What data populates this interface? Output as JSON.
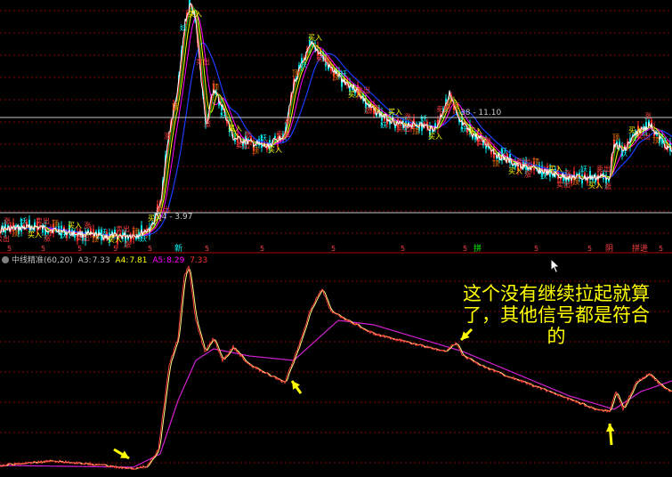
{
  "colors": {
    "background": "#000000",
    "grid": "#8a0000",
    "price_line": "#ffffff",
    "ma_blue": "#1a3cff",
    "ma_yellow": "#ffff00",
    "ma_magenta": "#ff00ff",
    "ma_red": "#ff2020",
    "ma_green": "#00c000",
    "annotation": "#ffff00"
  },
  "price_panel": {
    "high_marker": "38 - 11.10",
    "low_marker": "94 - 3.97"
  },
  "signal_tags": [
    "卖出",
    "买入",
    "妖",
    "顶",
    "涨"
  ],
  "bottom_markers": {
    "digit": "5",
    "label_1": "新",
    "label_2": "拼",
    "label_3": "阴",
    "label_4": "拼进"
  },
  "indicator": {
    "name": "中线精准(60,20)",
    "a3_label": "A3:",
    "a3_value": "7.33",
    "a4_label": "A4:",
    "a4_value": "7.81",
    "a5_label": "A5:",
    "a5_value": "8.29",
    "extra_value": "7.33"
  },
  "annotation": {
    "line1": "这个没有继续拉起就算",
    "line2": "了，其他信号都是符合",
    "line3": "的"
  },
  "arrows": [
    "arrow-1",
    "arrow-2",
    "arrow-3",
    "arrow-4"
  ]
}
